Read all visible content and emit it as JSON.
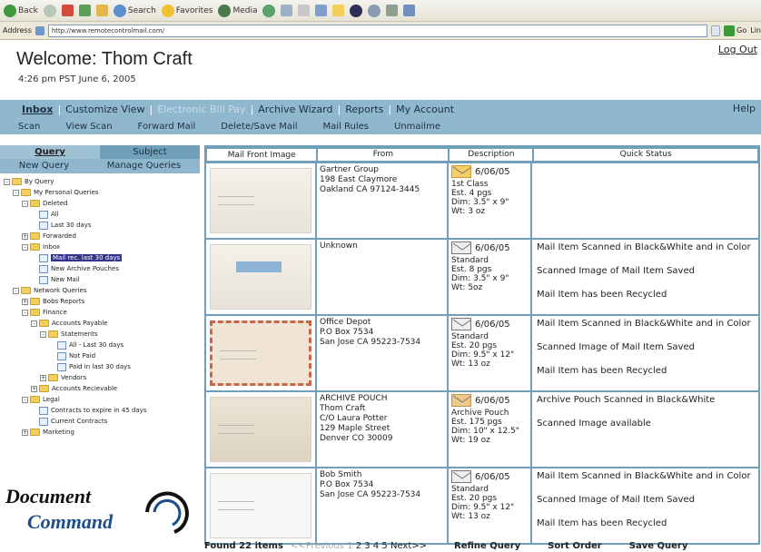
{
  "browser": {
    "buttons": [
      "Back",
      "Search",
      "Favorites",
      "Media"
    ],
    "address_label": "Address",
    "url": "http://www.remotecontrolmail.com/",
    "go_label": "Go",
    "links_label": "Lin"
  },
  "header": {
    "welcome": "Welcome: Thom Craft",
    "datetime": "4:26 pm  PST  June 6, 2005",
    "logout": "Log Out"
  },
  "nav": {
    "primary": [
      {
        "label": "Inbox",
        "state": "active"
      },
      {
        "label": "Customize View",
        "state": "normal"
      },
      {
        "label": "Electronic Bill Pay",
        "state": "disabled"
      },
      {
        "label": "Archive Wizard",
        "state": "normal"
      },
      {
        "label": "Reports",
        "state": "normal"
      },
      {
        "label": "My Account",
        "state": "normal"
      }
    ],
    "help": "Help",
    "secondary": [
      "Scan",
      "View Scan",
      "Forward Mail",
      "Delete/Save Mail",
      "Mail Rules",
      "Unmailme"
    ]
  },
  "sidebar": {
    "tab_query": "Query",
    "tab_subject": "Subject",
    "new_query": "New Query",
    "manage_queries": "Manage Queries",
    "tree": [
      {
        "level": 0,
        "exp": "-",
        "icon": "folder",
        "label": "By Query"
      },
      {
        "level": 1,
        "exp": "-",
        "icon": "folder",
        "label": "My Personal Queries"
      },
      {
        "level": 2,
        "exp": "-",
        "icon": "folder",
        "label": "Deleted"
      },
      {
        "level": 3,
        "exp": "",
        "icon": "query",
        "label": "All"
      },
      {
        "level": 3,
        "exp": "",
        "icon": "query",
        "label": "Last 30 days"
      },
      {
        "level": 2,
        "exp": "+",
        "icon": "folder",
        "label": "Forwarded"
      },
      {
        "level": 2,
        "exp": "-",
        "icon": "folder",
        "label": "Inbox"
      },
      {
        "level": 3,
        "exp": "",
        "icon": "query",
        "label": "Mail rec. last 30 days",
        "selected": true
      },
      {
        "level": 3,
        "exp": "",
        "icon": "query",
        "label": "New Archive Pouches"
      },
      {
        "level": 3,
        "exp": "",
        "icon": "query",
        "label": "New Mail"
      },
      {
        "level": 1,
        "exp": "-",
        "icon": "folder",
        "label": "Network Queries"
      },
      {
        "level": 2,
        "exp": "+",
        "icon": "folder",
        "label": "Bobs Reports"
      },
      {
        "level": 2,
        "exp": "-",
        "icon": "folder",
        "label": "Finance"
      },
      {
        "level": 3,
        "exp": "-",
        "icon": "folder",
        "label": "Accounts Payable"
      },
      {
        "level": 4,
        "exp": "-",
        "icon": "folder",
        "label": "Statements"
      },
      {
        "level": 5,
        "exp": "",
        "icon": "query",
        "label": "All - Last 30 days"
      },
      {
        "level": 5,
        "exp": "",
        "icon": "query",
        "label": "Not Paid"
      },
      {
        "level": 5,
        "exp": "",
        "icon": "query",
        "label": "Paid in last 30 days"
      },
      {
        "level": 4,
        "exp": "+",
        "icon": "folder",
        "label": "Vendors"
      },
      {
        "level": 3,
        "exp": "+",
        "icon": "folder",
        "label": "Accounts Recievable"
      },
      {
        "level": 2,
        "exp": "-",
        "icon": "folder",
        "label": "Legal"
      },
      {
        "level": 3,
        "exp": "",
        "icon": "query",
        "label": "Contracts to expire in 45 days"
      },
      {
        "level": 3,
        "exp": "",
        "icon": "query",
        "label": "Current Contracts"
      },
      {
        "level": 2,
        "exp": "+",
        "icon": "folder",
        "label": "Marketing"
      }
    ],
    "logo_line1": "Document",
    "logo_line2": "Command"
  },
  "table": {
    "columns": [
      "Mail Front Image",
      "From",
      "Description",
      "Quick Status"
    ],
    "rows": [
      {
        "thumb": "plain",
        "from": [
          "Gartner Group",
          "198 East Claymore",
          "Oakland  CA  97124-3445"
        ],
        "envelope": "yellow",
        "date": "6/06/05",
        "desc": [
          "1st Class",
          "Est. 4 pgs",
          "Dim: 3.5\" x 9\"",
          "Wt: 3 oz"
        ],
        "status": []
      },
      {
        "thumb": "blue",
        "from": [
          "Unknown"
        ],
        "envelope": "plain",
        "date": "6/06/05",
        "desc": [
          "Standard",
          "Est. 8 pgs",
          "Dim: 3.5\" x 9\"",
          "Wt: 5oz"
        ],
        "status": [
          "Mail Item Scanned in Black&White and in Color",
          "Scanned Image of Mail Item Saved",
          "Mail Item has been Recycled"
        ]
      },
      {
        "thumb": "red",
        "from": [
          "Office Depot",
          "P.O Box 7534",
          "San Jose  CA  95223-7534"
        ],
        "envelope": "plain",
        "date": "6/06/05",
        "desc": [
          "Standard",
          "Est. 20 pgs",
          "Dim: 9.5\" x 12\"",
          "Wt: 13 oz"
        ],
        "status": [
          "Mail Item Scanned in Black&White and in Color",
          "Scanned Image of Mail Item Saved",
          "Mail Item has been Recycled"
        ]
      },
      {
        "thumb": "pouch",
        "from": [
          "ARCHIVE POUCH",
          "Thom Craft",
          "C/O Laura Potter",
          "129 Maple Street",
          "Denver CO  30009"
        ],
        "envelope": "tan",
        "date": "6/06/05",
        "desc": [
          "Archive Pouch",
          "Est. 175 pgs",
          "Dim: 10\" x 12.5\"",
          "Wt: 19 oz"
        ],
        "status": [
          "Archive Pouch Scanned in Black&White",
          "Scanned Image available"
        ]
      },
      {
        "thumb": "white",
        "from": [
          "Bob Smith",
          "P.O Box 7534",
          "San Jose  CA  95223-7534"
        ],
        "envelope": "plain",
        "date": "6/06/05",
        "desc": [
          "Standard",
          "Est. 20 pgs",
          "Dim: 9.5\" x 12\"",
          "Wt: 13 oz"
        ],
        "status": [
          "Mail Item Scanned in Black&White and in Color",
          "Scanned Image of Mail Item Saved",
          "Mail Item has been Recycled"
        ]
      }
    ]
  },
  "footer": {
    "found": "Found 22 items",
    "prev": "<<Previous",
    "pages": [
      "1",
      "2",
      "3",
      "4",
      "5"
    ],
    "next": "Next>>",
    "refine": "Refine Query",
    "sort": "Sort Order",
    "save": "Save Query"
  },
  "colors": {
    "nav_bar": "#8fb8cf",
    "tab_active": "#9fc1d4",
    "tab_inactive": "#6f9fb9",
    "table_border": "#6f9fb9",
    "selected_node": "#33338a"
  }
}
